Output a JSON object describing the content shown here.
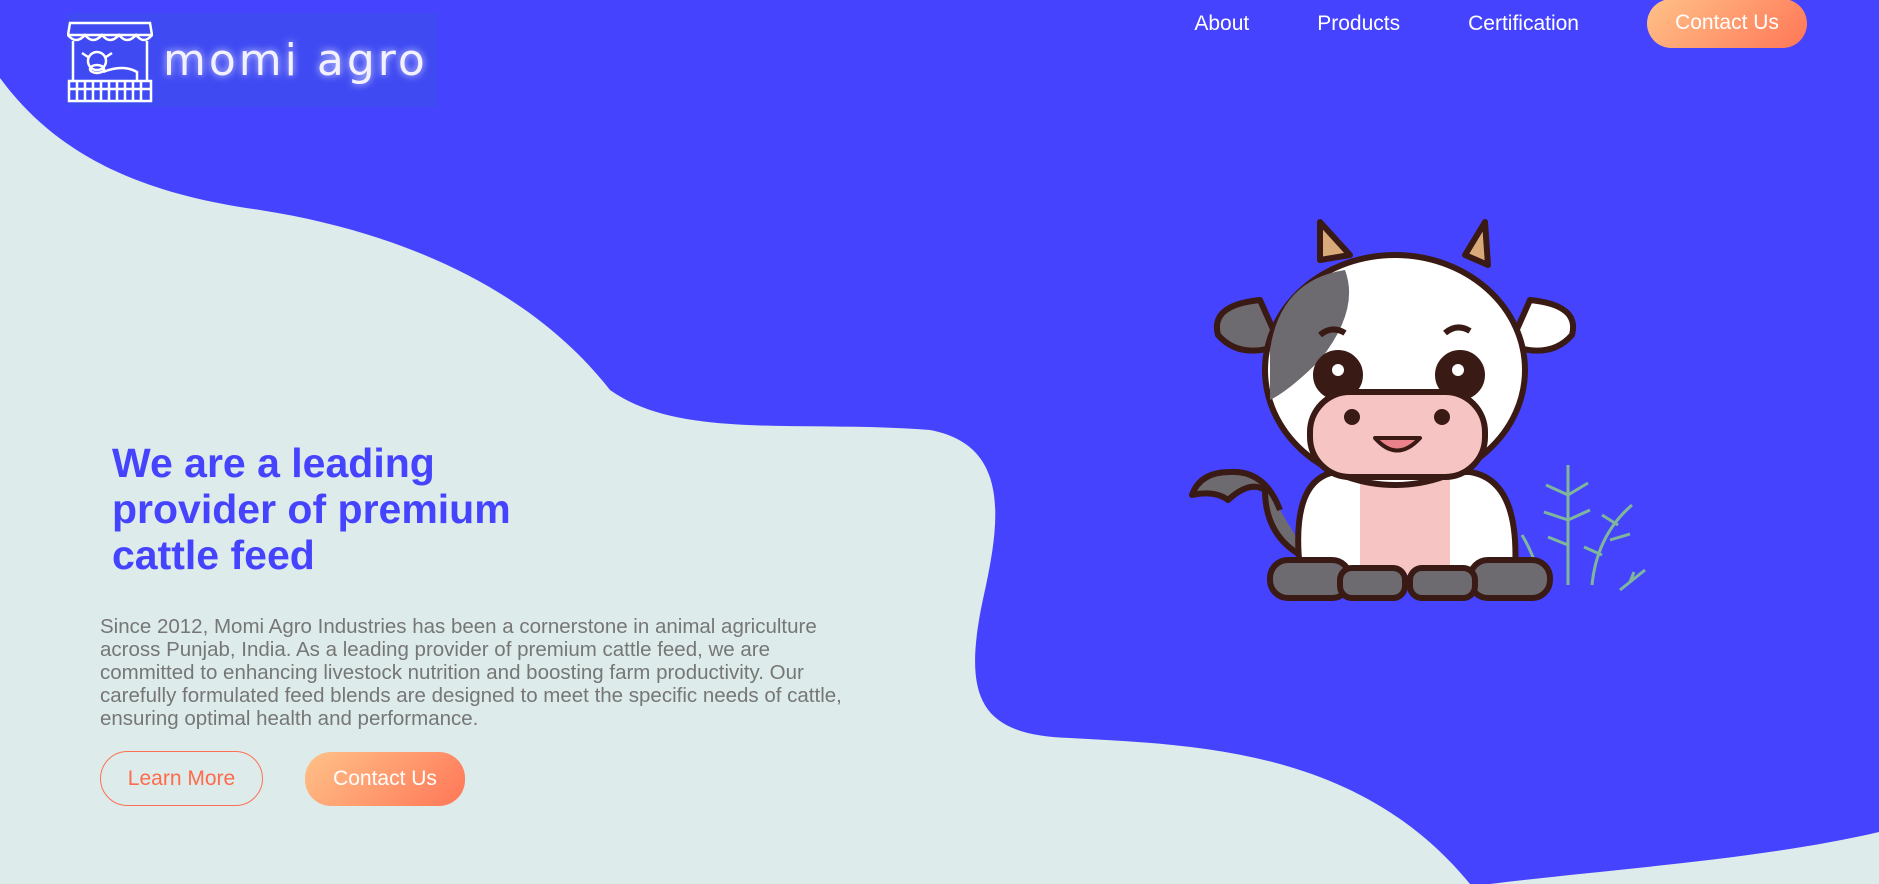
{
  "brand": {
    "name": "momi agro"
  },
  "nav": {
    "items": [
      "About",
      "Products",
      "Certification"
    ],
    "cta": "Contact Us"
  },
  "hero": {
    "heading": "We are a leading provider of premium cattle feed",
    "description": "Since 2012, Momi Agro Industries has been a cornerstone in animal agriculture across Punjab, India. As a leading provider of premium cattle feed, we are committed to enhancing livestock nutrition and boosting farm productivity. Our carefully formulated feed blends are designed to meet the specific needs of cattle, ensuring optimal health and performance.",
    "learn_more": "Learn More",
    "contact": "Contact Us"
  },
  "colors": {
    "primary": "#4643FF",
    "background": "#DDECEA",
    "accent": "#FF7657"
  }
}
